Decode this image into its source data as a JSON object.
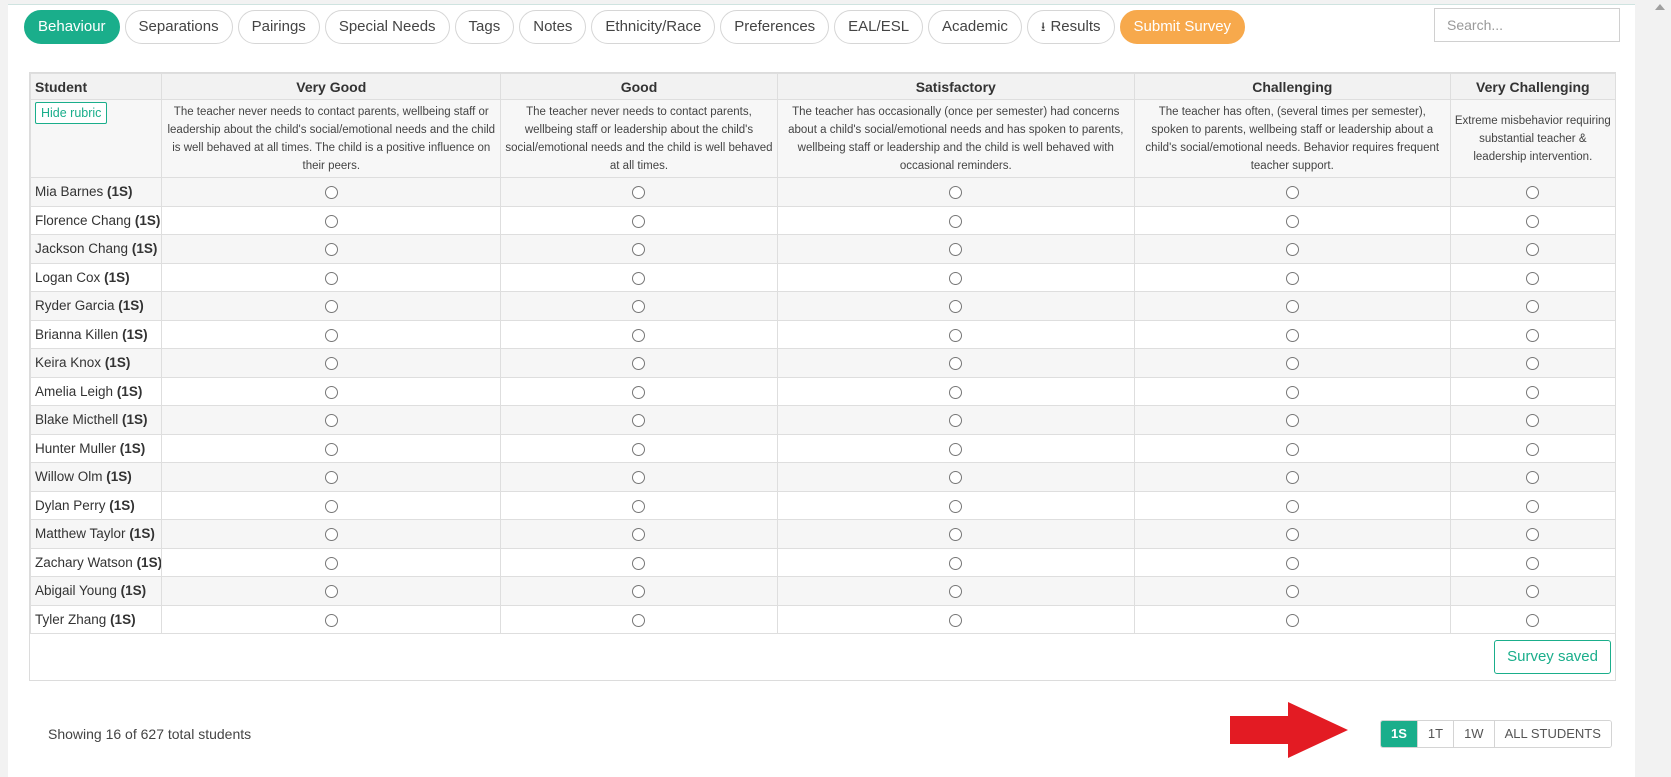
{
  "tabs": [
    {
      "label": "Behaviour",
      "state": "active"
    },
    {
      "label": "Separations",
      "state": ""
    },
    {
      "label": "Pairings",
      "state": ""
    },
    {
      "label": "Special Needs",
      "state": ""
    },
    {
      "label": "Tags",
      "state": ""
    },
    {
      "label": "Notes",
      "state": ""
    },
    {
      "label": "Ethnicity/Race",
      "state": ""
    },
    {
      "label": "Preferences",
      "state": ""
    },
    {
      "label": "EAL/ESL",
      "state": ""
    },
    {
      "label": "Academic",
      "state": ""
    },
    {
      "label": "Results",
      "state": "",
      "icon": "download-icon"
    },
    {
      "label": "Submit Survey",
      "state": "submit"
    }
  ],
  "search": {
    "placeholder": "Search..."
  },
  "table": {
    "student_header": "Student",
    "columns": [
      {
        "label": "Very Good",
        "rubric": "The teacher never needs to contact parents, wellbeing staff or leadership about the child's social/emotional needs and the child is well behaved at all times. The child is a positive influence on their peers."
      },
      {
        "label": "Good",
        "rubric": "The teacher never needs to contact parents, wellbeing staff or leadership about the child's social/emotional needs and the child is well behaved at all times."
      },
      {
        "label": "Satisfactory",
        "rubric": "The teacher has occasionally (once per semester) had concerns about a child's social/emotional needs and has spoken to parents, wellbeing staff or leadership and the child is well behaved with occasional reminders."
      },
      {
        "label": "Challenging",
        "rubric": "The teacher has often, (several times per semester), spoken to parents, wellbeing staff or leadership about a child's social/emotional needs. Behavior requires frequent teacher support."
      },
      {
        "label": "Very Challenging",
        "rubric": "Extreme misbehavior requiring substantial teacher & leadership intervention."
      }
    ],
    "hide_rubric_label": "Hide rubric",
    "students": [
      {
        "name": "Mia Barnes",
        "class": "(1S)"
      },
      {
        "name": "Florence Chang",
        "class": "(1S)"
      },
      {
        "name": "Jackson Chang",
        "class": "(1S)"
      },
      {
        "name": "Logan Cox",
        "class": "(1S)"
      },
      {
        "name": "Ryder Garcia",
        "class": "(1S)"
      },
      {
        "name": "Brianna Killen",
        "class": "(1S)"
      },
      {
        "name": "Keira Knox",
        "class": "(1S)"
      },
      {
        "name": "Amelia Leigh",
        "class": "(1S)"
      },
      {
        "name": "Blake Micthell",
        "class": "(1S)"
      },
      {
        "name": "Hunter Muller",
        "class": "(1S)"
      },
      {
        "name": "Willow Olm",
        "class": "(1S)"
      },
      {
        "name": "Dylan Perry",
        "class": "(1S)"
      },
      {
        "name": "Matthew Taylor",
        "class": "(1S)"
      },
      {
        "name": "Zachary Watson",
        "class": "(1S)"
      },
      {
        "name": "Abigail Young",
        "class": "(1S)"
      },
      {
        "name": "Tyler Zhang",
        "class": "(1S)"
      }
    ]
  },
  "survey_status": "Survey saved",
  "footer": {
    "showing_text": "Showing 16 of 627 total students",
    "pager": [
      {
        "label": "1S",
        "active": true
      },
      {
        "label": "1T",
        "active": false
      },
      {
        "label": "1W",
        "active": false
      },
      {
        "label": "ALL STUDENTS",
        "active": false
      }
    ]
  },
  "colors": {
    "accent": "#1aae8b",
    "submit": "#f7a94c",
    "annotation_arrow": "#e31b23"
  }
}
